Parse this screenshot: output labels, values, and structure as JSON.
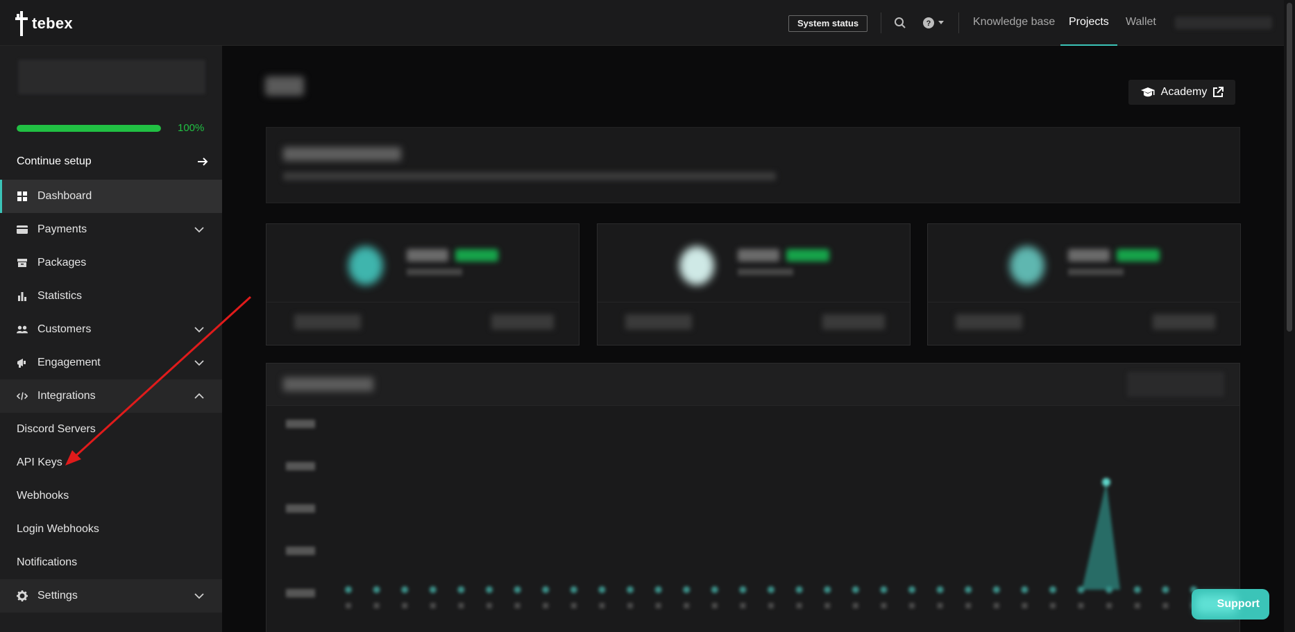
{
  "topbar": {
    "logo_text": "tebex",
    "system_status": "System status",
    "links": [
      "Knowledge base",
      "Projects",
      "Wallet"
    ],
    "active_link": "Projects",
    "accent": "#3bc4b8"
  },
  "sidebar": {
    "progress_percent": 100,
    "progress_label": "100%",
    "continue_setup": "Continue setup",
    "nav": [
      {
        "label": "Dashboard",
        "icon": "grid-icon",
        "active": true
      },
      {
        "label": "Payments",
        "icon": "credit-card-icon",
        "expandable": true
      },
      {
        "label": "Packages",
        "icon": "box-icon"
      },
      {
        "label": "Statistics",
        "icon": "bar-chart-icon"
      },
      {
        "label": "Customers",
        "icon": "users-icon",
        "expandable": true
      },
      {
        "label": "Engagement",
        "icon": "megaphone-icon",
        "expandable": true
      },
      {
        "label": "Integrations",
        "icon": "code-icon",
        "expanded": true
      }
    ],
    "integrations_sub": [
      "Discord Servers",
      "API Keys",
      "Webhooks",
      "Login Webhooks",
      "Notifications"
    ],
    "settings": {
      "label": "Settings",
      "icon": "gear-icon"
    }
  },
  "main": {
    "academy_label": "Academy"
  },
  "support_label": "Support",
  "colors": {
    "progress": "#21c043",
    "accent": "#3bc4b8",
    "arrow": "#e01b1b"
  }
}
